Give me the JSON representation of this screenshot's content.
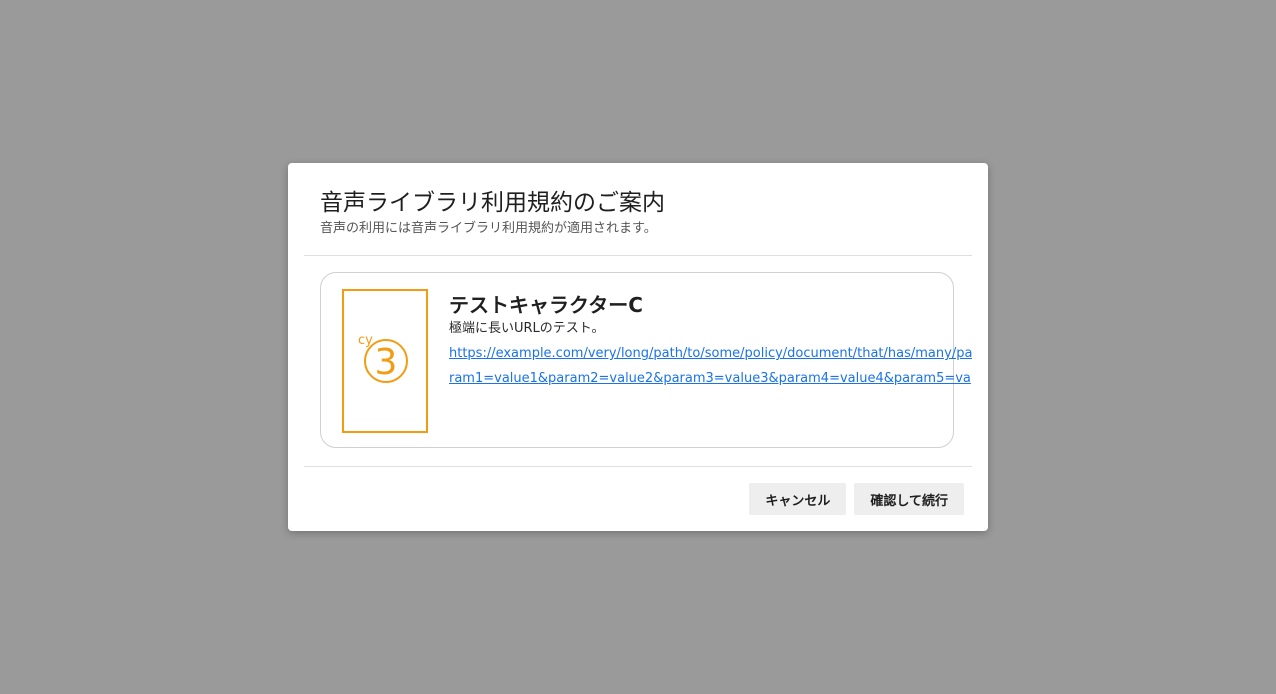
{
  "dialog": {
    "title": "音声ライブラリ利用規約のご案内",
    "subtitle": "音声の利用には音声ライブラリ利用規約が適用されます。"
  },
  "characters": [
    {
      "name": "テストキャラクターC",
      "description": "極端に長いURLのテスト。",
      "portrait_label": "cy",
      "portrait_number": "3",
      "link": "https://example.com/very/long/path/to/some/policy/document/that/has/many/param1=value1&param2=value2&param3=value3&param4=value4&param5=va"
    }
  ],
  "actions": {
    "cancel_label": "キャンセル",
    "confirm_label": "確認して続行"
  },
  "colors": {
    "overlay": "#9a9a9a",
    "accent": "#f39c12",
    "link": "#1a73e8"
  }
}
